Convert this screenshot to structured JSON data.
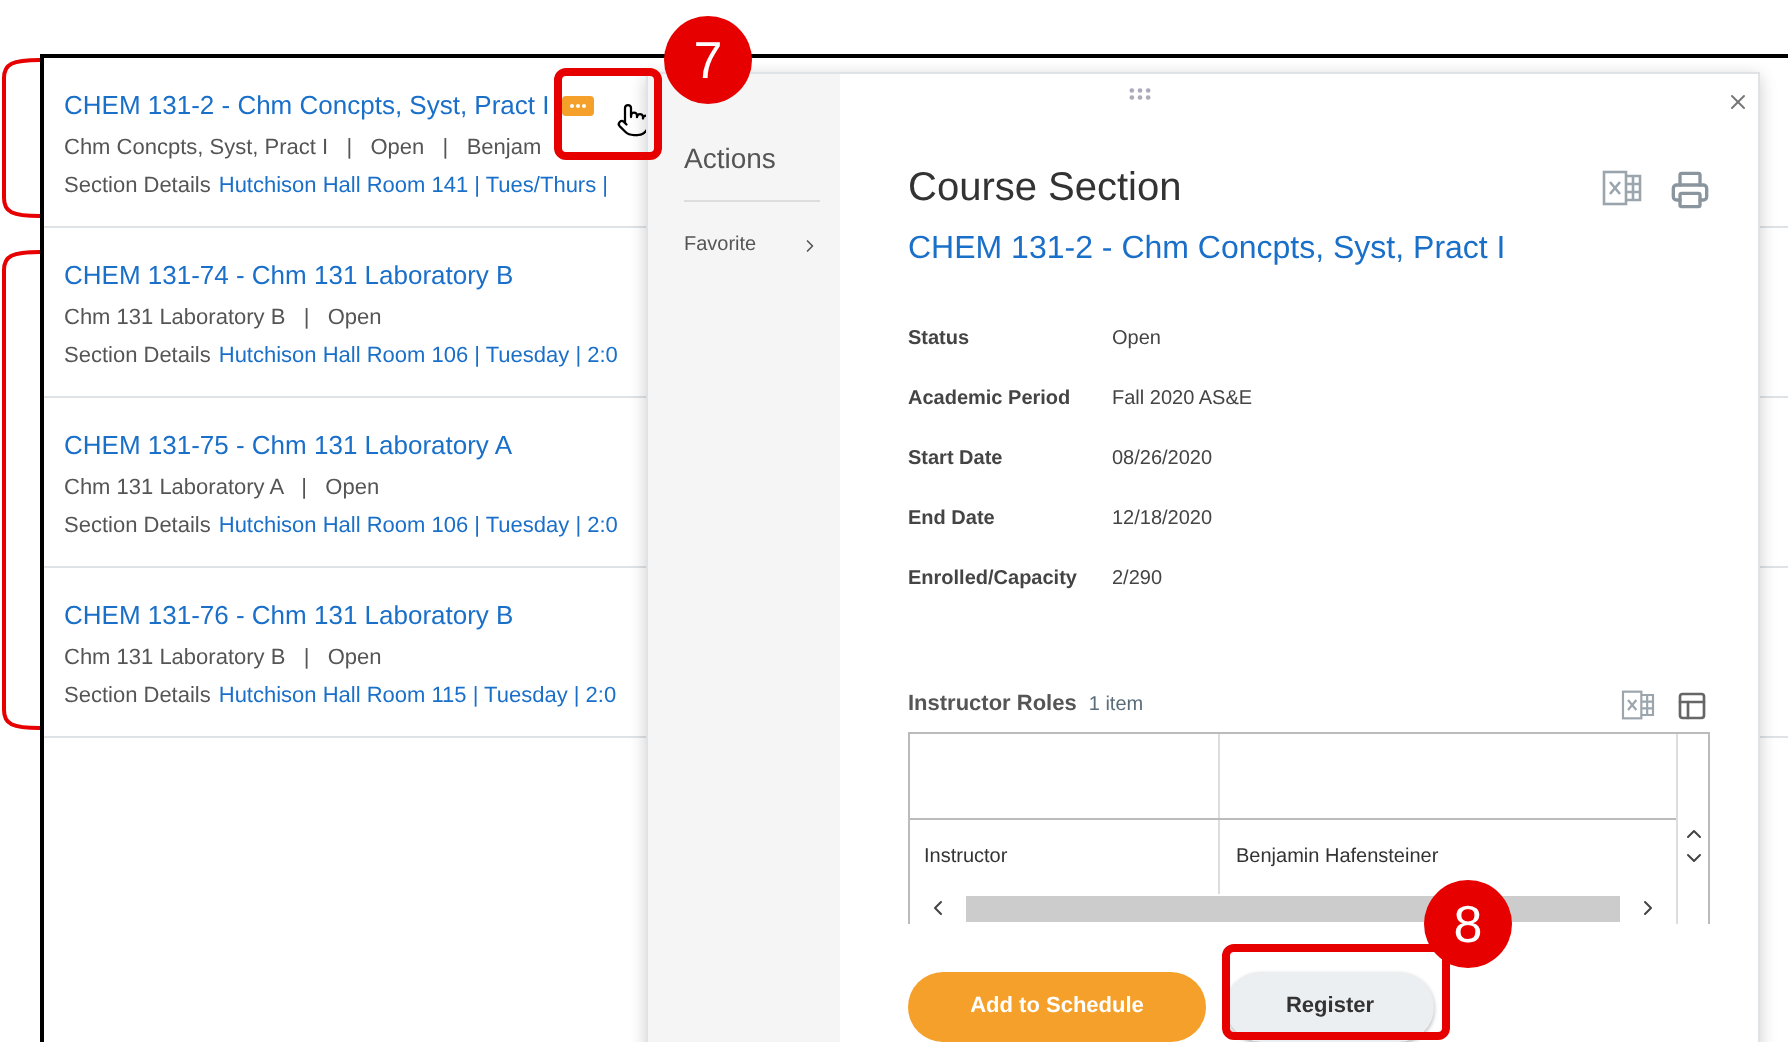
{
  "results": [
    {
      "title": "CHEM 131-2 - Chm Concpts, Syst, Pract I",
      "subtitle": "Chm Concpts, Syst, Pract I   |   Open   |   Benjam",
      "details_label": "Section Details",
      "details_link": "Hutchison Hall Room 141 | Tues/Thurs |",
      "has_menu": true
    },
    {
      "title": "CHEM 131-74 - Chm 131 Laboratory B",
      "subtitle": "Chm 131 Laboratory B   |   Open",
      "details_label": "Section Details",
      "details_link": "Hutchison Hall Room 106 | Tuesday | 2:0",
      "has_menu": false
    },
    {
      "title": "CHEM 131-75 - Chm 131 Laboratory A",
      "subtitle": "Chm 131 Laboratory A   |   Open",
      "details_label": "Section Details",
      "details_link": "Hutchison Hall Room 106 | Tuesday | 2:0",
      "has_menu": false
    },
    {
      "title": "CHEM 131-76 - Chm 131 Laboratory B",
      "subtitle": "Chm 131 Laboratory B   |   Open",
      "details_label": "Section Details",
      "details_link": "Hutchison Hall Room 115 | Tuesday | 2:0",
      "has_menu": false
    }
  ],
  "popup": {
    "actions": {
      "title": "Actions",
      "items": [
        {
          "label": "Favorite"
        }
      ]
    },
    "heading": "Course Section",
    "course_link": "CHEM 131-2 - Chm Concpts, Syst, Pract I",
    "fields": [
      {
        "label": "Status",
        "value": "Open"
      },
      {
        "label": "Academic Period",
        "value": "Fall 2020 AS&E"
      },
      {
        "label": "Start Date",
        "value": "08/26/2020"
      },
      {
        "label": "End Date",
        "value": "12/18/2020"
      },
      {
        "label": "Enrolled/Capacity",
        "value": "2/290"
      }
    ],
    "instructor_roles": {
      "title": "Instructor Roles",
      "count": "1 item",
      "rows": [
        {
          "role": "Instructor",
          "name": "Benjamin Hafensteiner"
        }
      ]
    },
    "buttons": [
      {
        "label": "Add to Schedule",
        "kind": "primary"
      },
      {
        "label": "Register",
        "kind": "secondary"
      }
    ]
  },
  "callouts": [
    {
      "label": "7"
    },
    {
      "label": "8"
    }
  ]
}
